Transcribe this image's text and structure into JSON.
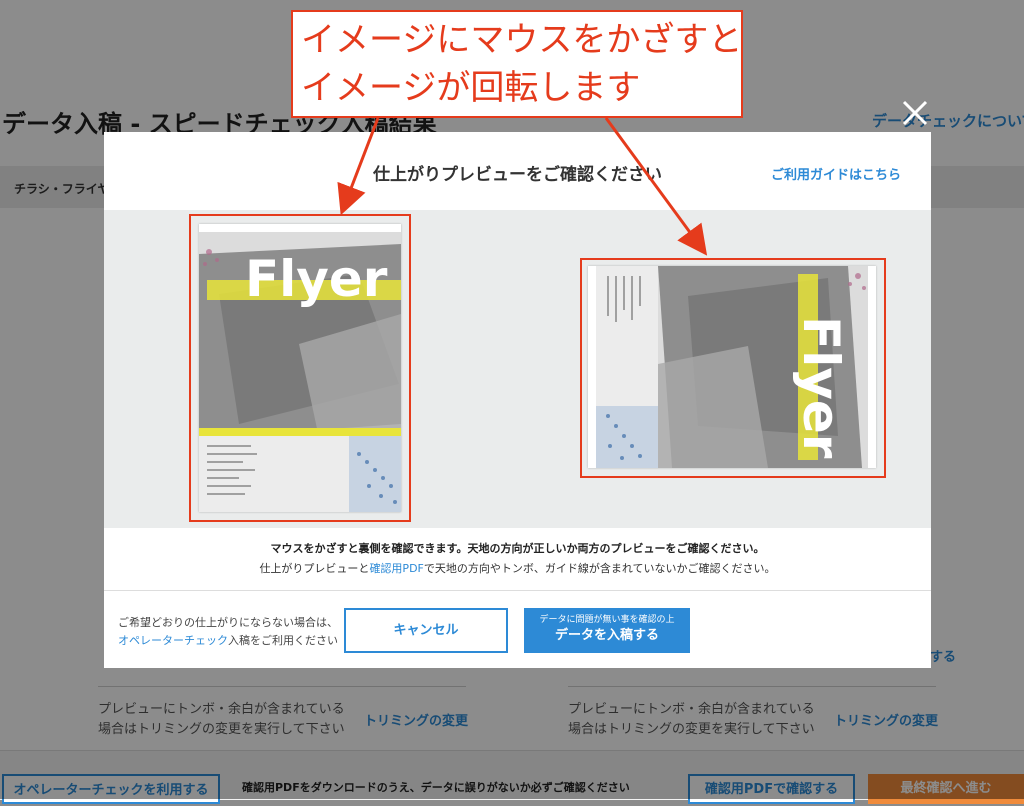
{
  "background": {
    "page_title": "データ入稿 - スピードチェック入稿結果",
    "data_check_link": "データチェックについて",
    "breadcrumb": "チラシ・フライヤー",
    "side_link_suffix": "する",
    "trim_note_left": "プレビューにトンボ・余白が含まれている場合はトリミングの変更を実行して下さい",
    "trim_note_right": "プレビューにトンボ・余白が含まれている場合はトリミングの変更を実行して下さい",
    "trim_button": "トリミングの変更",
    "operator_button": "オペレーターチェックを利用する",
    "footer_text": "確認用PDFをダウンロードのうえ、データに誤りがないか必ずご確認ください",
    "pdf_button": "確認用PDFで確認する",
    "next_button": "最終確認へ進む"
  },
  "modal": {
    "title": "仕上がりプレビューをご確認ください",
    "guide_link": "ご利用ガイドはこちら",
    "description_line1": "マウスをかざすと裏側を確認できます。天地の方向が正しいか両方のプレビューをご確認ください。",
    "description_line2_pre": "仕上がりプレビューと",
    "description_line2_link": "確認用PDF",
    "description_line2_post": "で天地の方向やトンボ、ガイド線が含まれていないかご確認ください。",
    "footer_note_line1": "ご希望どおりの仕上がりにならない場合は、",
    "footer_note_link": "オペレーターチェック",
    "footer_note_line2_post": "入稿をご利用ください",
    "cancel_button": "キャンセル",
    "submit_small": "データに問題が無い事を確認の上",
    "submit_big": "データを入稿する",
    "flyer_text": "Flyer"
  },
  "annotation": {
    "line1": "イメージにマウスをかざすと",
    "line2": "イメージが回転します"
  },
  "colors": {
    "accent_blue": "#2d8ad6",
    "annotation_red": "#e53b1c",
    "next_orange": "#f08b3b",
    "flyer_yellow": "#e8e43a"
  }
}
